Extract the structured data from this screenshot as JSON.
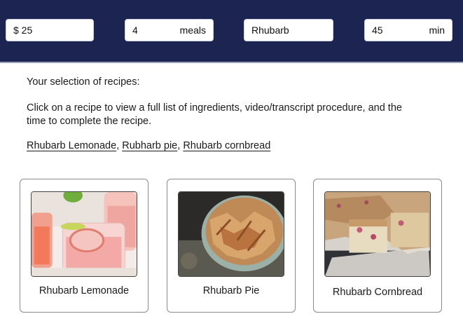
{
  "filters": {
    "budget": {
      "value": "$ 25"
    },
    "meals": {
      "value": "4",
      "unit": "meals"
    },
    "ingredient": {
      "value": "Rhubarb"
    },
    "time": {
      "value": "45",
      "unit": "min"
    }
  },
  "content": {
    "intro": "Your selection of recipes:",
    "instructions": "Click on a recipe to view a full list of ingredients, video/transcript procedure, and the time to complete the recipe.",
    "links": [
      "Rhubarb Lemonade",
      "Rubharb pie",
      "Rhubarb cornbread"
    ],
    "separator": ", "
  },
  "recipes": [
    {
      "title": "Rhubarb Lemonade",
      "image": "lemonade-photo"
    },
    {
      "title": "Rhubarb Pie",
      "image": "pie-photo"
    },
    {
      "title": "Rhubarb Cornbread",
      "image": "cornbread-photo"
    }
  ],
  "colors": {
    "header_bg": "#1c2452",
    "field_bg": "#ffffff",
    "card_border": "#8a8a8a"
  }
}
